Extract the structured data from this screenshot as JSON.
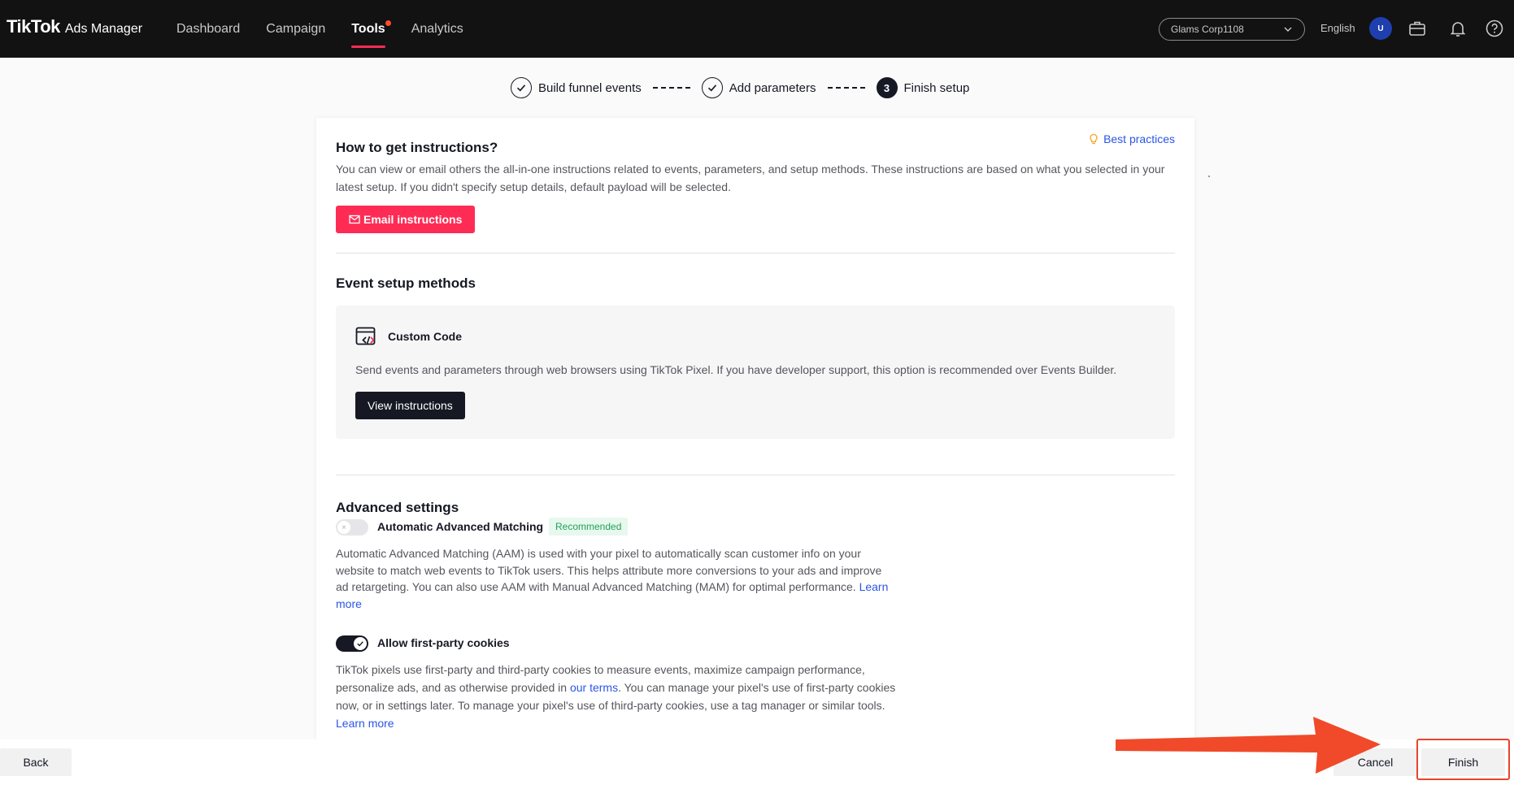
{
  "header": {
    "logo_main": "TikTok",
    "logo_sub": "Ads Manager",
    "nav": [
      {
        "label": "Dashboard"
      },
      {
        "label": "Campaign"
      },
      {
        "label": "Tools"
      },
      {
        "label": "Analytics"
      }
    ],
    "active_nav": "Tools",
    "account": "Glams Corp1108",
    "language": "English",
    "avatar_initial": "U",
    "icons": [
      "briefcase-icon",
      "bell-icon",
      "help-icon"
    ]
  },
  "stepper": {
    "steps": [
      {
        "label": "Build funnel events",
        "state": "done"
      },
      {
        "label": "Add parameters",
        "state": "done"
      },
      {
        "label": "Finish setup",
        "state": "current",
        "number": "3"
      }
    ]
  },
  "instructions": {
    "title": "How to get instructions?",
    "best_practices": "Best practices",
    "description": "You can view or email others the all-in-one instructions related to events, parameters, and setup methods. These instructions are based on what you selected in your latest setup. If you didn't specify setup details, default payload will be selected.",
    "email_button": "Email instructions"
  },
  "setup_methods": {
    "title": "Event setup methods",
    "method_name": "Custom Code",
    "method_description": "Send events and parameters through web browsers using TikTok Pixel. If you have developer support, this option is recommended over Events Builder.",
    "view_button": "View instructions"
  },
  "advanced": {
    "title": "Advanced settings",
    "aam": {
      "label": "Automatic Advanced Matching",
      "badge": "Recommended",
      "enabled": false,
      "description": "Automatic Advanced Matching (AAM) is used with your pixel to automatically scan customer info on your website to match web events to TikTok users. This helps attribute more conversions to your ads and improve ad retargeting. You can also use AAM with Manual Advanced Matching (MAM) for optimal performance.",
      "learn_more": "Learn more"
    },
    "cookies": {
      "label": "Allow first-party cookies",
      "enabled": true,
      "description_pre": "TikTok pixels use first-party and third-party cookies to measure events, maximize campaign performance, personalize ads, and as otherwise provided in",
      "terms_link": "our terms",
      "description_post": ". You can manage your pixel's use of first-party cookies now, or in settings later. To manage your pixel's use of third-party cookies, use a tag manager or similar tools.",
      "learn_more": "Learn more"
    }
  },
  "footer": {
    "back": "Back",
    "cancel": "Cancel",
    "finish": "Finish"
  },
  "colors": {
    "primary": "#fe2c55",
    "link": "#2a56e6",
    "annotation": "#e8442c"
  }
}
